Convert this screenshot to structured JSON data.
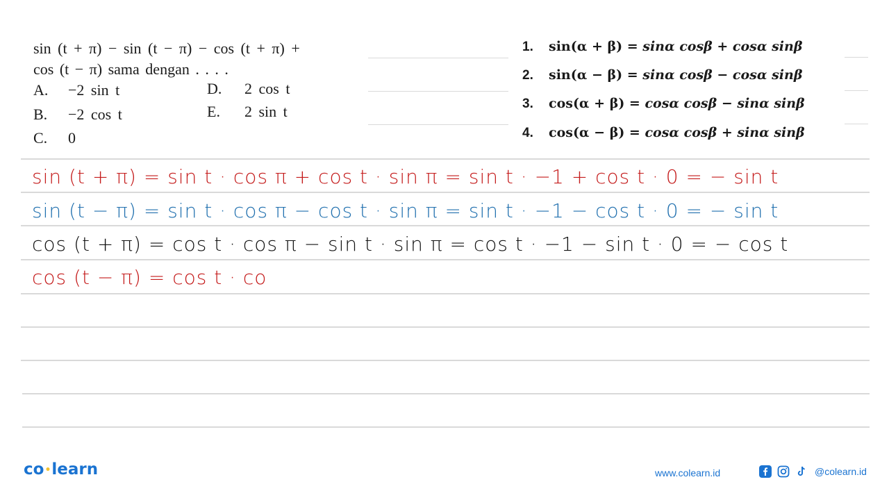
{
  "question": {
    "line1": "sin (t + π) − sin (t − π) − cos (t + π) +",
    "line2": "cos (t − π) sama dengan . . . .",
    "options": [
      {
        "letter": "A.",
        "value": "−2 sin t"
      },
      {
        "letter": "B.",
        "value": "−2 cos t"
      },
      {
        "letter": "C.",
        "value": "0"
      },
      {
        "letter": "D.",
        "value": "2 cos t"
      },
      {
        "letter": "E.",
        "value": "2 sin t"
      }
    ]
  },
  "formulas": [
    {
      "num": "1.",
      "lhs": "sin(α + β) = ",
      "rhs": "sinα cosβ + cosα sinβ"
    },
    {
      "num": "2.",
      "lhs": "sin(α − β) = ",
      "rhs": "sinα cosβ − cosα sinβ"
    },
    {
      "num": "3.",
      "lhs": "cos(α + β) = ",
      "rhs": "cosα cosβ − sinα sinβ"
    },
    {
      "num": "4.",
      "lhs": "cos(α − β) = ",
      "rhs": "cosα cosβ + sinα sinβ"
    }
  ],
  "handwriting": [
    {
      "text": "sin (t + π) = sin t · cos π + cos t · sin π  =  sin t · −1 + cos t · 0 = − sin t",
      "color": "red"
    },
    {
      "text": "sin (t − π)  = sin t · cos π − cos t · sin π  =  sin t · −1 − cos t · 0 = − sin t",
      "color": "blue"
    },
    {
      "text": "cos (t + π)  = cos t · cos π − sin t · sin π = cos t · −1 − sin t · 0 = − cos t",
      "color": "black"
    },
    {
      "text": "cos (t − π)  = cos t · co",
      "color": "red"
    }
  ],
  "footer": {
    "logo_left": "co",
    "logo_dot": "•",
    "logo_right": "learn",
    "website": "www.colearn.id",
    "handle": "@colearn.id",
    "icons": [
      "facebook-icon",
      "instagram-icon",
      "tiktok-icon"
    ]
  }
}
